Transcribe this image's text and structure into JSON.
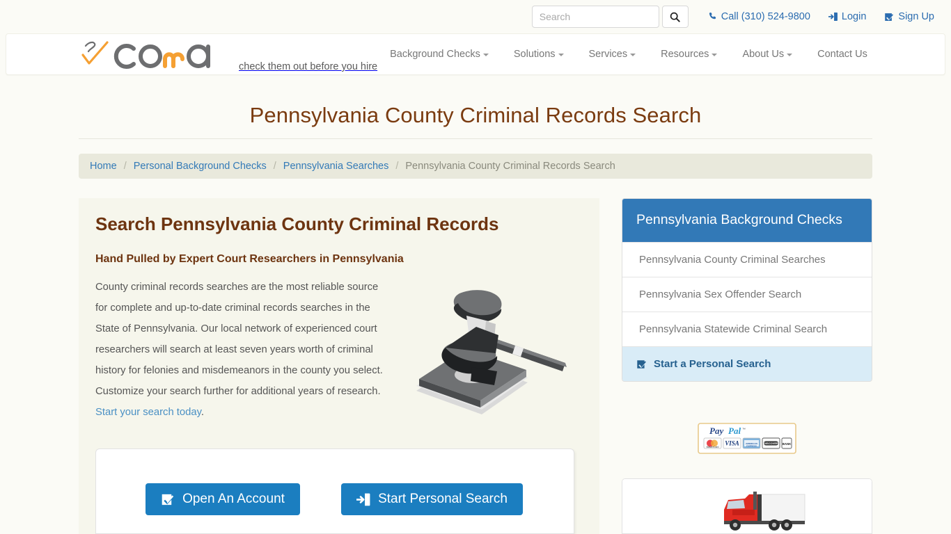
{
  "topbar": {
    "search": {
      "placeholder": "Search",
      "value": ""
    },
    "search_icon": "search-icon",
    "phone": {
      "icon": "phone-icon",
      "label": "Call (310) 524-9800"
    },
    "login": {
      "icon": "login-icon",
      "label": "Login"
    },
    "signup": {
      "icon": "check-square-icon",
      "label": "Sign Up"
    }
  },
  "brand": {
    "logo_text": "corra",
    "tagline": "check them out before you hire"
  },
  "nav": {
    "items": [
      {
        "label": "Background Checks",
        "has_caret": true
      },
      {
        "label": "Solutions",
        "has_caret": true
      },
      {
        "label": "Services",
        "has_caret": true
      },
      {
        "label": "Resources",
        "has_caret": true
      },
      {
        "label": "About Us",
        "has_caret": true
      },
      {
        "label": "Contact Us",
        "has_caret": false
      }
    ]
  },
  "page": {
    "title": "Pennsylvania County Criminal Records Search"
  },
  "breadcrumb": {
    "items": [
      {
        "label": "Home",
        "link": true
      },
      {
        "label": "Personal Background Checks",
        "link": true
      },
      {
        "label": "Pennsylvania Searches",
        "link": true
      },
      {
        "label": "Pennsylvania County Criminal Records Search",
        "link": false
      }
    ],
    "separator": "/"
  },
  "main": {
    "heading": "Search Pennsylvania County Criminal Records",
    "subheading": "Hand Pulled by Expert Court Researchers in Pennsylvania",
    "body_text": "County criminal records searches are the most reliable source for complete and up-to-date criminal records searches in the State of Pennsylvania. Our local network of experienced court researchers will search at least seven years worth of criminal history for felonies and misdemeanors in the county you select. Customize your search further for additional years of research. ",
    "body_link": "Start your search today",
    "body_tail": ".",
    "illustration": "gavel-image",
    "buttons": {
      "open_account": {
        "icon": "check-square-icon",
        "label": "Open An Account"
      },
      "start_search": {
        "icon": "sign-in-icon",
        "label": "Start Personal Search"
      }
    }
  },
  "sidebar": {
    "heading": "Pennsylvania Background Checks",
    "items": [
      {
        "label": "Pennsylvania County Criminal Searches",
        "active": false
      },
      {
        "label": "Pennsylvania Sex Offender Search",
        "active": false
      },
      {
        "label": "Pennsylvania Statewide Criminal Search",
        "active": false
      },
      {
        "label": "Start a Personal Search",
        "active": true,
        "icon": "check-square-icon"
      }
    ],
    "paypal": {
      "title": "PayPal",
      "cards": [
        "MasterCard",
        "VISA",
        "AMERICAN EXPRESS",
        "DISCOVER",
        "BANK"
      ]
    },
    "promo_image": "red-semi-truck-image"
  },
  "colors": {
    "accent_blue": "#1b7ec0",
    "header_blue": "#3279b7",
    "link_blue": "#337ab7",
    "title_brown": "#7a3b10",
    "heading_brown": "#6d3410",
    "breadcrumb_bg": "#e9e9dc",
    "panel_bg": "#f6f6ec",
    "logo_orange": "#f5a033",
    "logo_gray": "#6d6e70",
    "active_item_bg": "#d9ecf7"
  }
}
